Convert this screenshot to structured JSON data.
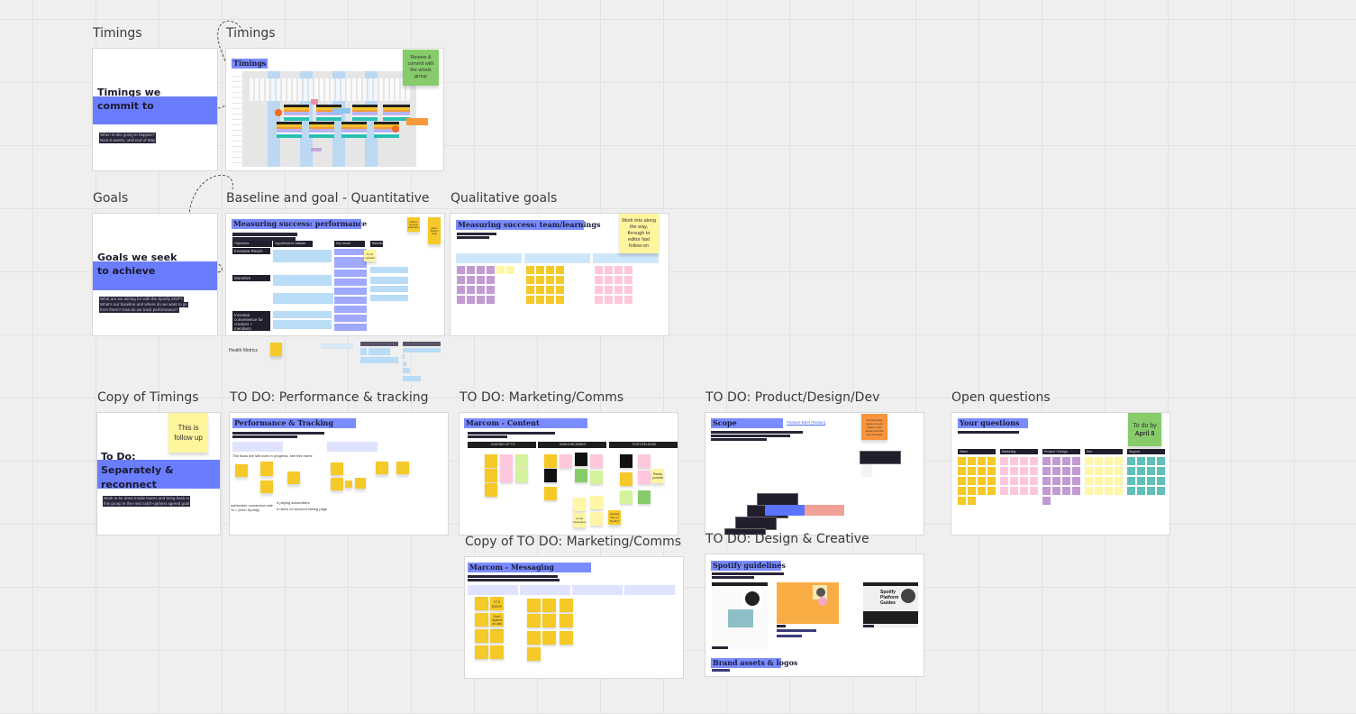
{
  "board": {
    "frames": {
      "timings": {
        "title": "Timings",
        "big_line1": "Timings we",
        "big_line2": "commit to",
        "sub_line1": "When is this going to happen?",
        "sub_line2": "Next 8 weeks, until end of May"
      },
      "timings_chart": {
        "title": "Timings",
        "heading": "Timings",
        "sticky": "Review & commit with the whole group"
      },
      "goals": {
        "title": "Goals",
        "big_line1": "Goals we seek",
        "big_line2": "to achieve",
        "sub_line1": "What are we aiming for with the Spotify MVP?",
        "sub_line2": "What's our baseline and where do we want to go",
        "sub_line3": "from there? How do we track performance?"
      },
      "quantitative": {
        "title": "Baseline and goal - Quantitative",
        "heading": "Measuring success: performance",
        "columns": [
          "Objectives",
          "Hypothesis to validate",
          "Key result",
          "Baseline"
        ],
        "objectives": [
          "Increase Reach",
          "Monetize",
          "Increase convenience for creators + members"
        ],
        "sticky_note": "To be updated",
        "sticky_small_1": "Data for not yet in production",
        "sticky_small_2": "goals / metrics / audit",
        "health_metrics": "Health Metrics"
      },
      "qualitative": {
        "title": "Qualitative goals",
        "heading": "Measuring success: team/learnings",
        "sticky": "Work into along the way, through to editor fast follow-on"
      },
      "copy_timings": {
        "title": "Copy of Timings",
        "big_line1": "To Do:",
        "big_line2": "Separately &",
        "big_line3": "reconnect",
        "sub_line1": "Work to be done inside teams and bring back to",
        "sub_line2": "this group in the next catch-up/next agreed goal",
        "sticky": "This is follow up"
      },
      "perf_tracking": {
        "title": "TO DO: Performance & tracking",
        "heading": "Performance & Tracking",
        "note": "The flows are still work in progress, see this frame",
        "text_1": "subscriber conversion rate % = (from Spotify)",
        "text_2": "# paying subscribers",
        "text_3": "# users on account linking page"
      },
      "marketing": {
        "title": "TO DO: Marketing/Comms",
        "heading": "Marcom - Content",
        "columns": [
          "LEADING UP TO",
          "ANNOUNCEMENT",
          "POST-RELEASE"
        ],
        "sticky_1": "Ready podcast",
        "sticky_2": "social campaigns",
        "sticky_3": "podcast ads on Spotify?"
      },
      "product": {
        "title": "TO DO: Product/Design/Dev",
        "heading": "Scope",
        "link": "Feature Brief (Notion)",
        "sticky": "To limit jointly agree on new phase of the project and the next 8 weeks"
      },
      "open_questions": {
        "title": "Open questions",
        "heading": "Your questions",
        "columns": [
          "Sales",
          "Marketing",
          "Product / Design",
          "Dev",
          "Support"
        ],
        "sticky_line1": "To do by",
        "sticky_line2": "April 8"
      },
      "copy_marketing": {
        "title": "Copy of TO DO: Marketing/Comms",
        "heading": "Marcom - Messaging",
        "sticky_1": "IT'S EASY!",
        "sticky_2": "Don't depend on ads"
      },
      "design": {
        "title": "TO DO: Design & Creative",
        "heading": "Spotify guidelines",
        "heading_2": "Brand assets & logos",
        "guide_title": "Spotify Platform Guides"
      }
    }
  }
}
